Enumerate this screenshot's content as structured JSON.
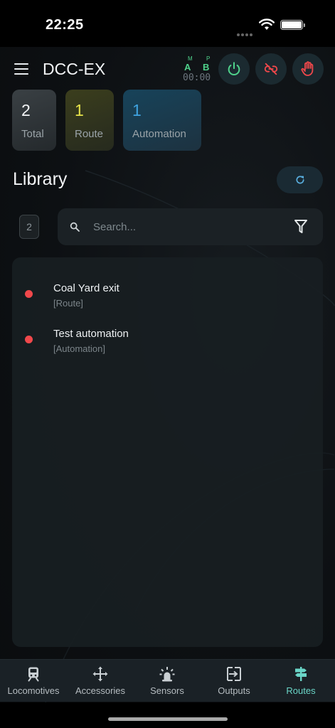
{
  "status_bar": {
    "time": "22:25"
  },
  "app_bar": {
    "title": "DCC-EX",
    "track": {
      "a_mode": "M",
      "a_label": "A",
      "b_mode": "P",
      "b_label": "B",
      "clock": "00:00"
    }
  },
  "stats": [
    {
      "value": "2",
      "label": "Total",
      "color": "#f2f4f6"
    },
    {
      "value": "1",
      "label": "Route",
      "color": "#e6e34a"
    },
    {
      "value": "1",
      "label": "Automation",
      "color": "#3fa3e0"
    }
  ],
  "library": {
    "title": "Library",
    "count": "2",
    "search_placeholder": "Search...",
    "search_value": "",
    "items": [
      {
        "name": "Coal Yard exit",
        "type": "[Route]",
        "status_color": "#f0484b"
      },
      {
        "name": "Test automation",
        "type": "[Automation]",
        "status_color": "#f0484b"
      }
    ]
  },
  "nav": {
    "items": [
      {
        "label": "Locomotives",
        "icon": "train-icon"
      },
      {
        "label": "Accessories",
        "icon": "move-arrows-icon"
      },
      {
        "label": "Sensors",
        "icon": "beacon-icon"
      },
      {
        "label": "Outputs",
        "icon": "output-icon"
      },
      {
        "label": "Routes",
        "icon": "signpost-icon"
      }
    ],
    "active": "Routes"
  },
  "colors": {
    "accent": "#6ad5c7",
    "power": "#4fd18b",
    "danger": "#f0484b"
  }
}
